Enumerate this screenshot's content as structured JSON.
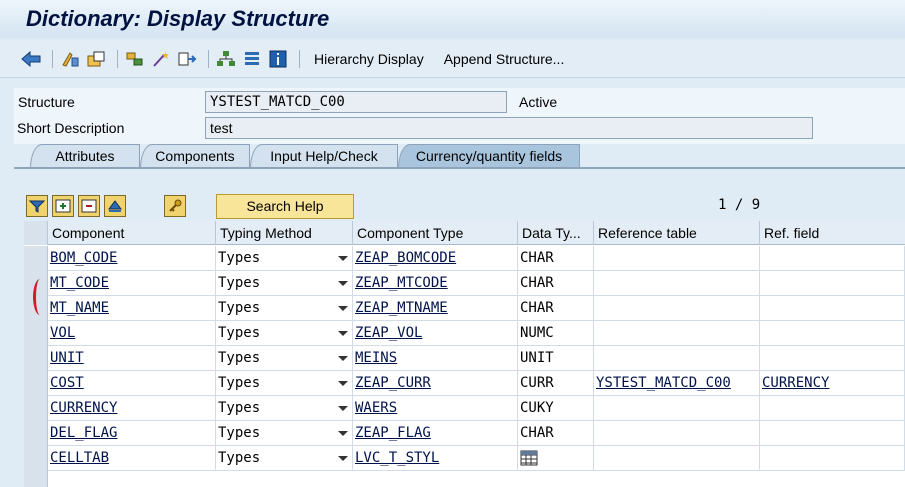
{
  "title": "Dictionary: Display Structure",
  "toolbar": {
    "hierarchy_display": "Hierarchy Display",
    "append_structure": "Append Structure..."
  },
  "header": {
    "structure_label": "Structure",
    "structure_value": "YSTEST_MATCD_C00",
    "status": "Active",
    "short_desc_label": "Short Description",
    "short_desc_value": "test"
  },
  "tabs": [
    "Attributes",
    "Components",
    "Input Help/Check",
    "Currency/quantity fields"
  ],
  "table_toolbar": {
    "search_help": "Search Help",
    "page_counter": "1 / 9"
  },
  "columns": [
    "Component",
    "Typing Method",
    "Component Type",
    "Data Ty...",
    "Reference table",
    "Ref. field"
  ],
  "rows": [
    {
      "component": "BOM_CODE",
      "typing": "Types",
      "comp_type": "ZEAP_BOMCODE",
      "data_type": "CHAR",
      "ref_table": "",
      "ref_field": ""
    },
    {
      "component": "MT_CODE",
      "typing": "Types",
      "comp_type": "ZEAP_MTCODE",
      "data_type": "CHAR",
      "ref_table": "",
      "ref_field": ""
    },
    {
      "component": "MT_NAME",
      "typing": "Types",
      "comp_type": "ZEAP_MTNAME",
      "data_type": "CHAR",
      "ref_table": "",
      "ref_field": ""
    },
    {
      "component": "VOL",
      "typing": "Types",
      "comp_type": "ZEAP_VOL",
      "data_type": "NUMC",
      "ref_table": "",
      "ref_field": ""
    },
    {
      "component": "UNIT",
      "typing": "Types",
      "comp_type": "MEINS",
      "data_type": "UNIT",
      "ref_table": "",
      "ref_field": ""
    },
    {
      "component": "COST",
      "typing": "Types",
      "comp_type": "ZEAP_CURR",
      "data_type": "CURR",
      "ref_table": "YSTEST_MATCD_C00",
      "ref_field": "CURRENCY"
    },
    {
      "component": "CURRENCY",
      "typing": "Types",
      "comp_type": "WAERS",
      "data_type": "CUKY",
      "ref_table": "",
      "ref_field": ""
    },
    {
      "component": "DEL_FLAG",
      "typing": "Types",
      "comp_type": "ZEAP_FLAG",
      "data_type": "CHAR",
      "ref_table": "",
      "ref_field": ""
    },
    {
      "component": "CELLTAB",
      "typing": "Types",
      "comp_type": "LVC_T_STYL",
      "data_type": "",
      "ref_table": "",
      "ref_field": ""
    }
  ]
}
